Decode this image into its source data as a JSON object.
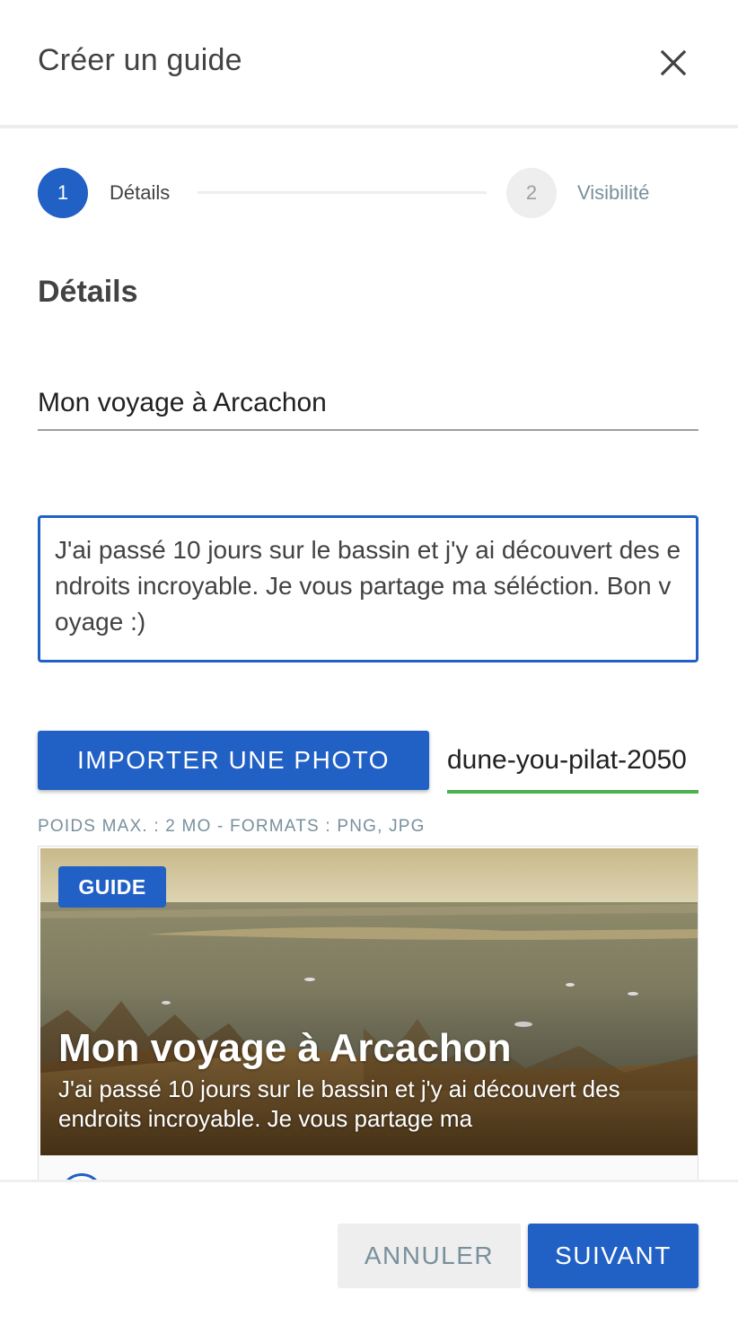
{
  "dialog": {
    "title": "Créer un guide",
    "close_icon": "close-icon"
  },
  "stepper": {
    "steps": [
      {
        "number": "1",
        "label": "Détails",
        "active": true
      },
      {
        "number": "2",
        "label": "Visibilité",
        "active": false
      }
    ]
  },
  "form": {
    "section_title": "Détails",
    "title_value": "Mon voyage à Arcachon",
    "description_value": "J'ai passé 10 jours sur le bassin et j'y ai découvert des endroits incroyable. Je vous partage ma séléction. Bon voyage :)",
    "upload_label": "IMPORTER UNE PHOTO",
    "file_name": "dune-you-pilat-2050",
    "file_hint": "POIDS MAX. : 2 MO - FORMATS : PNG, JPG"
  },
  "preview": {
    "badge": "GUIDE",
    "title": "Mon voyage à Arcachon",
    "description": "J'ai passé 10 jours sur le bassin et j'y ai découvert des endroits incroyable. Je vous partage ma"
  },
  "footer": {
    "cancel_label": "ANNULER",
    "next_label": "SUIVANT"
  },
  "colors": {
    "primary": "#2160c4",
    "success": "#4caf50",
    "muted": "#78909c"
  }
}
